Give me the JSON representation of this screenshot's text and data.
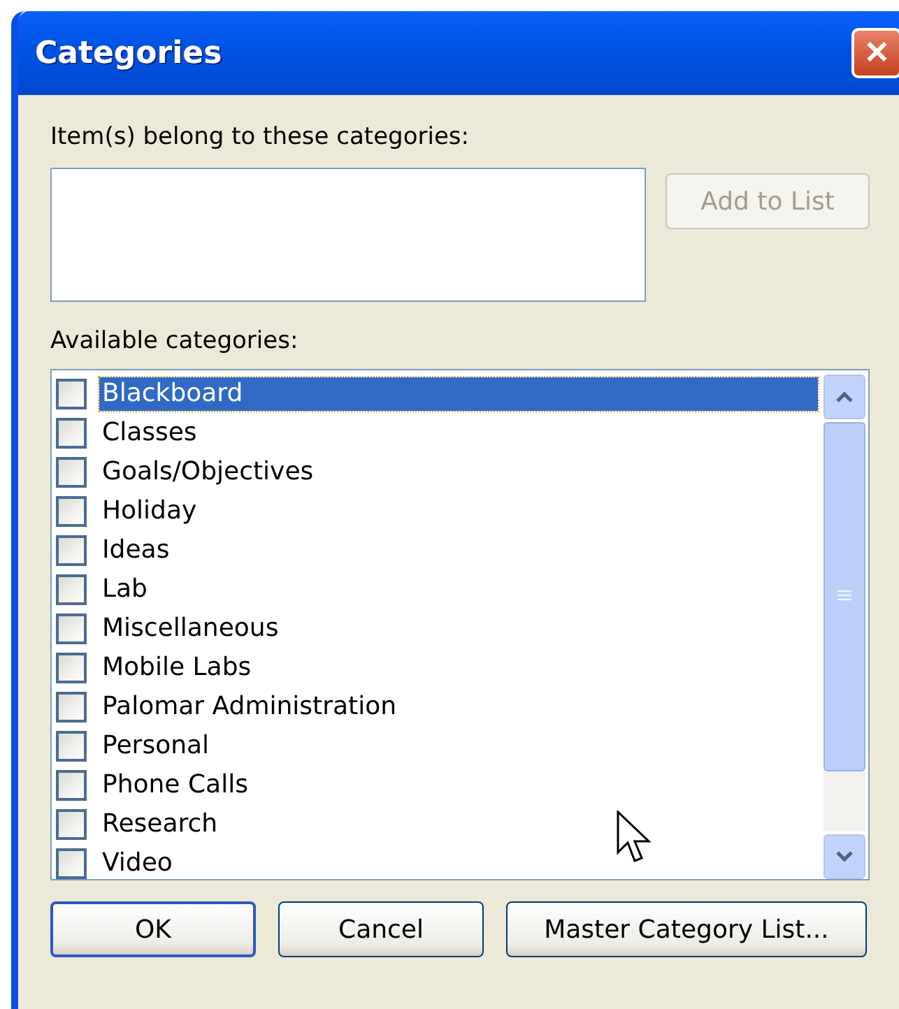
{
  "window": {
    "title": "Categories",
    "close": "✕"
  },
  "assigned": {
    "label": "Item(s) belong to these categories:"
  },
  "add_button": {
    "label": "Add to List",
    "disabled": true
  },
  "available": {
    "label": "Available categories:",
    "items": [
      {
        "name": "Blackboard",
        "checked": false,
        "selected": true
      },
      {
        "name": "Classes",
        "checked": false,
        "selected": false
      },
      {
        "name": "Goals/Objectives",
        "checked": false,
        "selected": false
      },
      {
        "name": "Holiday",
        "checked": false,
        "selected": false
      },
      {
        "name": "Ideas",
        "checked": false,
        "selected": false
      },
      {
        "name": "Lab",
        "checked": false,
        "selected": false
      },
      {
        "name": "Miscellaneous",
        "checked": false,
        "selected": false
      },
      {
        "name": "Mobile Labs",
        "checked": false,
        "selected": false
      },
      {
        "name": "Palomar Administration",
        "checked": false,
        "selected": false
      },
      {
        "name": "Personal",
        "checked": false,
        "selected": false
      },
      {
        "name": "Phone Calls",
        "checked": false,
        "selected": false
      },
      {
        "name": "Research",
        "checked": false,
        "selected": false
      },
      {
        "name": "Video",
        "checked": false,
        "selected": false
      }
    ]
  },
  "buttons": [
    {
      "label": "OK",
      "kind": "default"
    },
    {
      "label": "Cancel",
      "kind": "normal"
    },
    {
      "label": "Master Category List...",
      "kind": "normal"
    }
  ]
}
